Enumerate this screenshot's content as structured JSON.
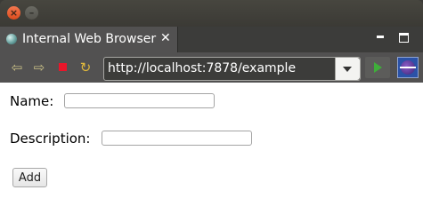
{
  "titlebar": {
    "close_glyph": "×",
    "minimize_glyph": "–"
  },
  "tab": {
    "icon": "globe-icon",
    "title": "Internal Web Browser",
    "close_glyph": "✕"
  },
  "view_controls": {
    "minimize_icon": "minimize-icon",
    "maximize_icon": "maximize-icon"
  },
  "toolbar": {
    "back_glyph": "⇦",
    "forward_glyph": "⇨",
    "stop_icon": "stop-icon",
    "refresh_glyph": "↻",
    "url": "http://localhost:7878/example",
    "go_icon": "go-icon",
    "eclipse_icon": "eclipse-icon"
  },
  "form": {
    "name_label": "Name:",
    "name_value": "",
    "description_label": "Description:",
    "description_value": "",
    "add_label": "Add"
  },
  "colors": {
    "stop": "#e8162a",
    "go": "#3fae3a",
    "close_button": "#e95420"
  }
}
